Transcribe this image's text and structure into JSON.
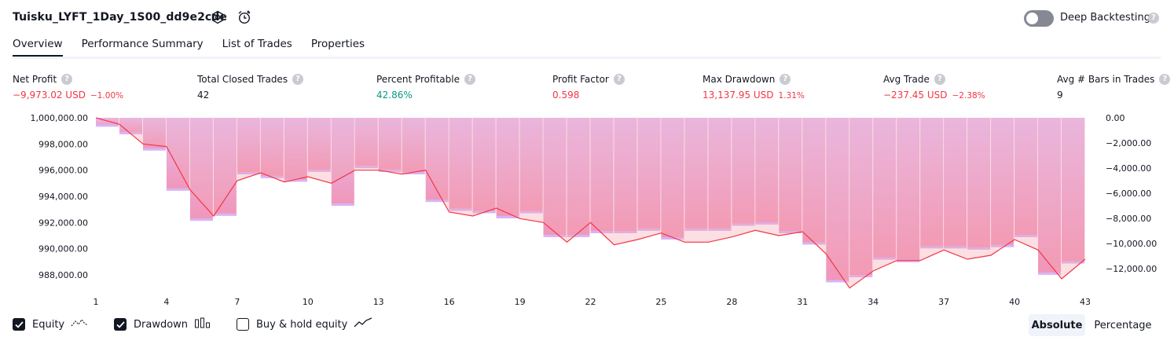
{
  "header": {
    "title": "Tuisku_LYFT_1Day_1S00_dd9e2cde",
    "deep_backtesting_label": "Deep Backtesting",
    "deep_backtesting_on": false,
    "help_glyph": "?"
  },
  "tabs": [
    {
      "label": "Overview",
      "active": true
    },
    {
      "label": "Performance Summary",
      "active": false
    },
    {
      "label": "List of Trades",
      "active": false
    },
    {
      "label": "Properties",
      "active": false
    }
  ],
  "stats": {
    "net_profit": {
      "label": "Net Profit",
      "value": "−9,973.02 USD",
      "sub": "−1.00%"
    },
    "total_closed_trades": {
      "label": "Total Closed Trades",
      "value": "42"
    },
    "percent_profitable": {
      "label": "Percent Profitable",
      "value": "42.86%"
    },
    "profit_factor": {
      "label": "Profit Factor",
      "value": "0.598"
    },
    "max_drawdown": {
      "label": "Max Drawdown",
      "value": "13,137.95 USD",
      "sub": "1.31%"
    },
    "avg_trade": {
      "label": "Avg Trade",
      "value": "−237.45 USD",
      "sub": "−2.38%"
    },
    "avg_bars": {
      "label": "Avg # Bars in Trades",
      "value": "9"
    }
  },
  "chart_data": {
    "type": "area",
    "x_ticks": [
      "1",
      "4",
      "7",
      "10",
      "13",
      "16",
      "19",
      "22",
      "25",
      "28",
      "31",
      "34",
      "37",
      "40",
      "43"
    ],
    "left_axis": {
      "ticks": [
        "1,000,000.00",
        "998,000.00",
        "996,000.00",
        "994,000.00",
        "992,000.00",
        "990,000.00",
        "988,000.00"
      ],
      "ylim": [
        987400,
        1000000
      ]
    },
    "right_axis": {
      "ticks": [
        "0.00",
        "−2,000.00",
        "−4,000.00",
        "−6,000.00",
        "−8,000.00",
        "−10,000.00",
        "−12,000.00"
      ],
      "ylim": [
        -13140,
        0
      ]
    },
    "series": [
      {
        "name": "Equity",
        "color": "#f23645",
        "x": [
          1,
          2,
          3,
          4,
          5,
          6,
          7,
          8,
          9,
          10,
          11,
          12,
          13,
          14,
          15,
          16,
          17,
          18,
          19,
          20,
          21,
          22,
          23,
          24,
          25,
          26,
          27,
          28,
          29,
          30,
          31,
          32,
          33,
          34,
          35,
          36,
          37,
          38,
          39,
          40,
          41,
          42,
          43
        ],
        "values": [
          1000000,
          999500,
          998000,
          997800,
          994500,
          992500,
          995200,
          995800,
          995100,
          995500,
          995000,
          996000,
          996000,
          995700,
          996000,
          992800,
          992500,
          993100,
          992300,
          992000,
          990500,
          992000,
          990300,
          990700,
          991200,
          990500,
          990500,
          990900,
          991400,
          991000,
          991300,
          989600,
          987000,
          988300,
          989100,
          989100,
          989900,
          989200,
          989500,
          990700,
          989900,
          987700,
          989200
        ]
      },
      {
        "name": "Drawdown",
        "color": "#ce93d8",
        "x": [
          1,
          2,
          3,
          4,
          5,
          6,
          7,
          8,
          9,
          10,
          11,
          12,
          13,
          14,
          15,
          16,
          17,
          18,
          19,
          20,
          21,
          22,
          23,
          24,
          25,
          26,
          27,
          28,
          29,
          30,
          31,
          32,
          33,
          34,
          35,
          36,
          37,
          38,
          39,
          40,
          41,
          42,
          43
        ],
        "values": [
          0,
          -700,
          -1300,
          -2600,
          -5800,
          -8200,
          -7800,
          -4500,
          -4800,
          -5100,
          -4300,
          -7000,
          -4000,
          -4300,
          -4500,
          -6700,
          -7400,
          -7600,
          -8000,
          -7600,
          -9500,
          -9500,
          -9200,
          -9200,
          -9000,
          -9700,
          -9000,
          -9000,
          -8600,
          -8500,
          -9200,
          -10100,
          -13100,
          -12700,
          -11300,
          -11500,
          -10400,
          -10400,
          -10500,
          -10300,
          -9500,
          -12500,
          -11600
        ]
      }
    ]
  },
  "legend": {
    "equity": {
      "label": "Equity",
      "checked": true,
      "icon": "equity-line-icon"
    },
    "drawdown": {
      "label": "Drawdown",
      "checked": true,
      "icon": "drawdown-bars-icon"
    },
    "buy_hold": {
      "label": "Buy & hold equity",
      "checked": false,
      "icon": "buy-hold-line-icon"
    }
  },
  "view_toggle": {
    "absolute": "Absolute",
    "percentage": "Percentage",
    "selected": "Absolute"
  }
}
